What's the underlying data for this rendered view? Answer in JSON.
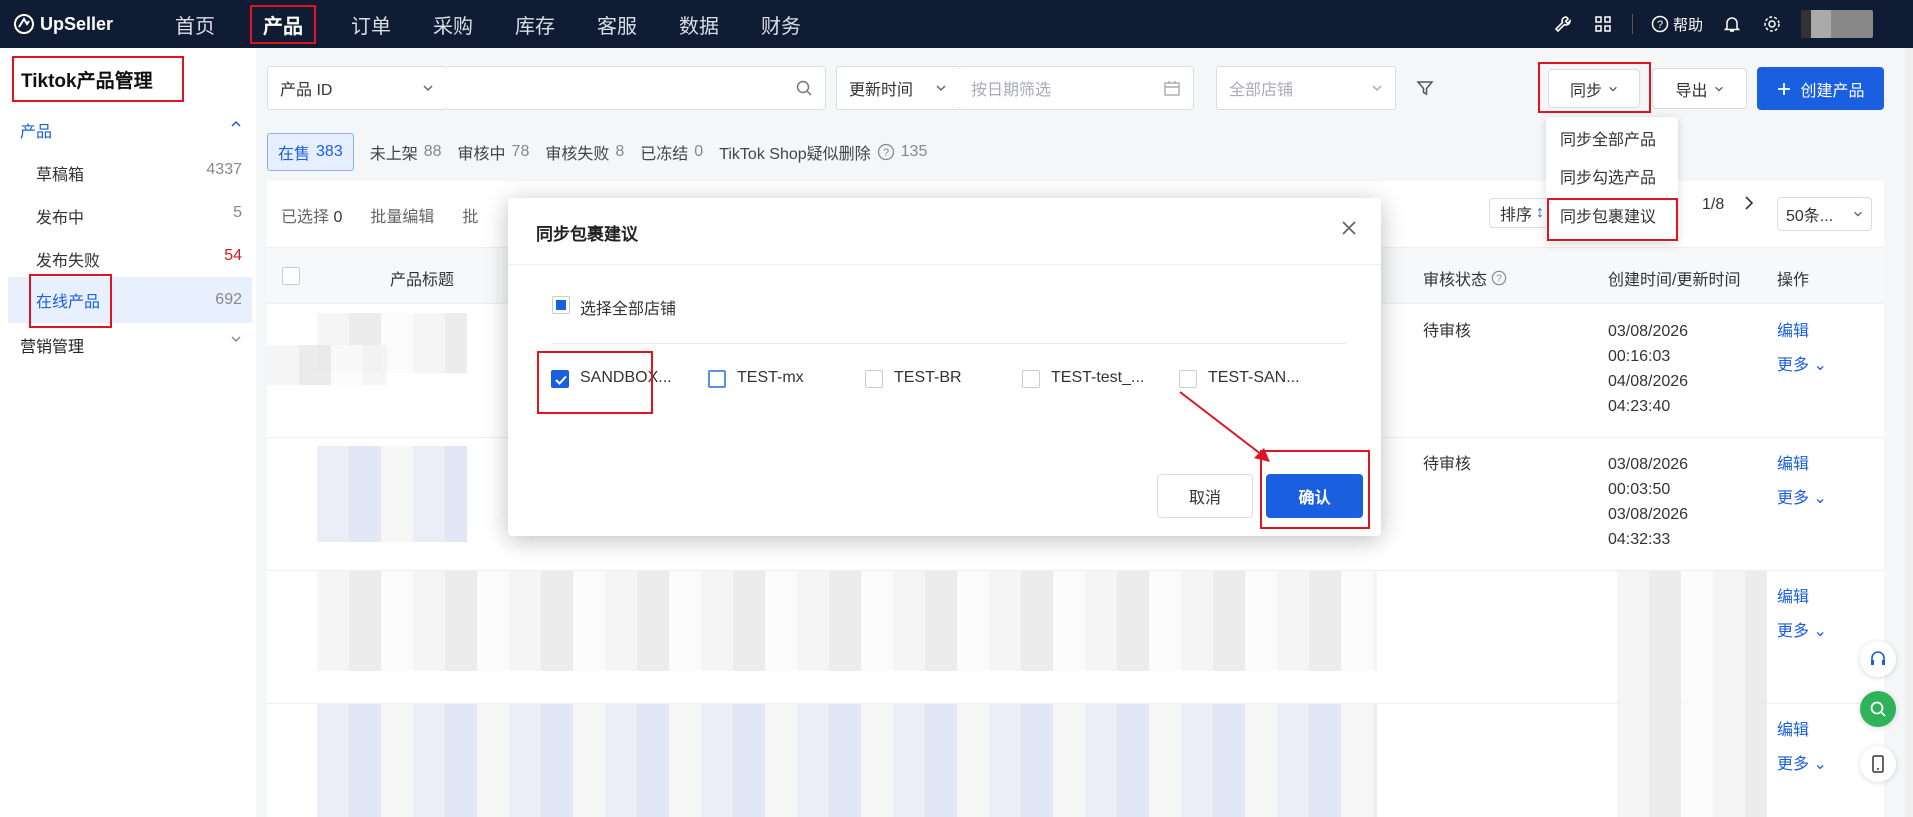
{
  "brand": {
    "name": "UpSeller"
  },
  "nav": {
    "items": [
      "首页",
      "产品",
      "订单",
      "采购",
      "库存",
      "客服",
      "数据",
      "财务"
    ],
    "active": "产品",
    "help": "帮助"
  },
  "sidebar": {
    "title": "Tiktok产品管理",
    "section_product": "产品",
    "items": [
      {
        "label": "草稿箱",
        "count": "4337"
      },
      {
        "label": "发布中",
        "count": "5"
      },
      {
        "label": "发布失败",
        "count": "54"
      },
      {
        "label": "在线产品",
        "count": "692"
      }
    ],
    "section_marketing": "营销管理"
  },
  "toolbar": {
    "id_select": "产品 ID",
    "search_value": "",
    "time_select": "更新时间",
    "date_placeholder": "按日期筛选",
    "store_placeholder": "全部店铺",
    "sync_label": "同步",
    "export_label": "导出",
    "create_label": "创建产品"
  },
  "sync_menu": {
    "items": [
      "同步全部产品",
      "同步勾选产品",
      "同步包裹建议"
    ]
  },
  "status_tabs": [
    {
      "label": "在售",
      "count": "383"
    },
    {
      "label": "未上架",
      "count": "88"
    },
    {
      "label": "审核中",
      "count": "78"
    },
    {
      "label": "审核失败",
      "count": "8"
    },
    {
      "label": "已冻结",
      "count": "0"
    },
    {
      "label": "TikTok Shop疑似删除",
      "count": "135"
    }
  ],
  "table_bar": {
    "selected_label": "已选择",
    "selected_count": "0",
    "batch_edit": "批量编辑",
    "batch_more": "批",
    "sort_label": "排序",
    "page": "1/8",
    "page_size": "50条..."
  },
  "table": {
    "headers": {
      "title": "产品标题",
      "review_status": "审核状态",
      "time": "创建时间/更新时间",
      "actions": "操作"
    },
    "rows": [
      {
        "status": "待审核",
        "created_date": "03/08/2026",
        "created_time": "00:16:03",
        "updated_date": "04/08/2026",
        "updated_time": "04:23:40",
        "edit": "编辑",
        "more": "更多"
      },
      {
        "status": "待审核",
        "created_date": "03/08/2026",
        "created_time": "00:03:50",
        "updated_date": "03/08/2026",
        "updated_time": "04:32:33",
        "edit": "编辑",
        "more": "更多"
      },
      {
        "status": "",
        "created_date": "",
        "created_time": "",
        "updated_date": "",
        "updated_time": "",
        "edit": "编辑",
        "more": "更多"
      },
      {
        "status": "",
        "created_date": "",
        "created_time": "",
        "updated_date": "",
        "updated_time": "",
        "edit": "编辑",
        "more": "更多"
      }
    ]
  },
  "modal": {
    "title": "同步包裹建议",
    "select_all": "选择全部店铺",
    "stores": [
      {
        "name": "SANDBOX...",
        "checked": true
      },
      {
        "name": "TEST-mx",
        "checked": false
      },
      {
        "name": "TEST-BR",
        "checked": false
      },
      {
        "name": "TEST-test_...",
        "checked": false
      },
      {
        "name": "TEST-SAN...",
        "checked": false
      }
    ],
    "cancel": "取消",
    "confirm": "确认"
  },
  "colors": {
    "primary": "#1a5fe0",
    "nav_bg": "#0f1c33",
    "highlight": "#e0141e"
  }
}
